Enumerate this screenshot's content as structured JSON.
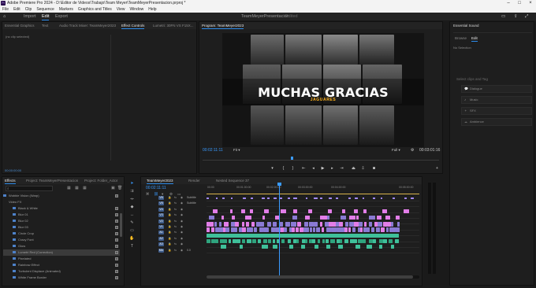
{
  "app": {
    "title": "Adobe Premiere Pro 2024 - D:\\Editor de Videos\\Trabajo\\Team Meyer\\TeamMeyerPresentacion.prproj *",
    "menus": [
      "File",
      "Edit",
      "Clip",
      "Sequence",
      "Markers",
      "Graphics and Titles",
      "View",
      "Window",
      "Help"
    ]
  },
  "workspace": {
    "tabs": [
      "Import",
      "Edit",
      "Export"
    ],
    "active": "Edit",
    "project_name": "TeamMeyerPresentacion",
    "edited_label": "Edited"
  },
  "source_panel": {
    "tabs": [
      "Essential Graphics",
      "Text",
      "Audio Track Mixer: TeamMeyer2023",
      "Effect Controls",
      "Lumetri: 30FN VS F15X..."
    ],
    "active_tab": "Effect Controls",
    "no_clip": "(no clip selected)",
    "timecode": "00:00:00:00"
  },
  "program_monitor": {
    "tab": "Program: TeamMeyer2023",
    "headline": "MUCHAS GRACIAS",
    "subhead": "JAGUARES",
    "timecode": "00:02:11:11",
    "fit": "Fit",
    "quality": "Full",
    "duration": "00:03:01:16"
  },
  "effects_panel": {
    "tabs": [
      "Effects",
      "Project: TeamMeyerPresentacion",
      "Project: Folder_Actor"
    ],
    "items": [
      {
        "label": "Wobble Vision (Warp)",
        "sel": false
      },
      {
        "label": "Video FX",
        "sel": false
      },
      {
        "label": "Black & White",
        "sel": false
      },
      {
        "label": "Blur 01",
        "sel": false
      },
      {
        "label": "Blur 02",
        "sel": false
      },
      {
        "label": "Blur 03",
        "sel": false
      },
      {
        "label": "Circle Crop",
        "sel": false
      },
      {
        "label": "Crazy Font",
        "sel": false
      },
      {
        "label": "Glow",
        "sel": false
      },
      {
        "label": "Lumetri Red (Correction)",
        "sel": true
      },
      {
        "label": "Pixelated",
        "sel": false
      },
      {
        "label": "Rainbow Effect",
        "sel": false
      },
      {
        "label": "Turbulent Displace (Animated)",
        "sel": false
      },
      {
        "label": "White Frame Border",
        "sel": false
      }
    ]
  },
  "timeline": {
    "tabs": [
      "TeamMeyer2023",
      "Render",
      "Nested Sequence 37"
    ],
    "active_tab": "TeamMeyer2023",
    "timecode": "00:02:11:11",
    "ruler": [
      "00:00",
      "00:01:00:00",
      "00:02:00:00",
      "00:03:00:00",
      "00:04:00:00",
      "00:05:00:00"
    ],
    "tracks": [
      {
        "name": "V6",
        "label": "Subtitle"
      },
      {
        "name": "V5",
        "label": "Subtitle"
      },
      {
        "name": "V4",
        "label": ""
      },
      {
        "name": "V3",
        "label": ""
      },
      {
        "name": "V2",
        "label": ""
      },
      {
        "name": "V1",
        "label": ""
      },
      {
        "name": "A1",
        "label": ""
      },
      {
        "name": "A2",
        "label": ""
      },
      {
        "name": "A3",
        "label": ""
      },
      {
        "name": "Mix",
        "label": "0.0"
      }
    ]
  },
  "essential_sound": {
    "title": "Essential Sound",
    "tabs": [
      "Browse",
      "Edit"
    ],
    "active_tab": "Edit",
    "no_selection": "No Selection",
    "prompt": "Select clips and Tag",
    "buttons": [
      "Dialogue",
      "Music",
      "SFX",
      "Ambience"
    ]
  },
  "colors": {
    "accent": "#2d8ceb",
    "clip_v_purple": "#8a7ad4",
    "clip_v_pink": "#e27ee8",
    "clip_a_green": "#3fc09a",
    "headline_sub": "#ffb21a"
  }
}
